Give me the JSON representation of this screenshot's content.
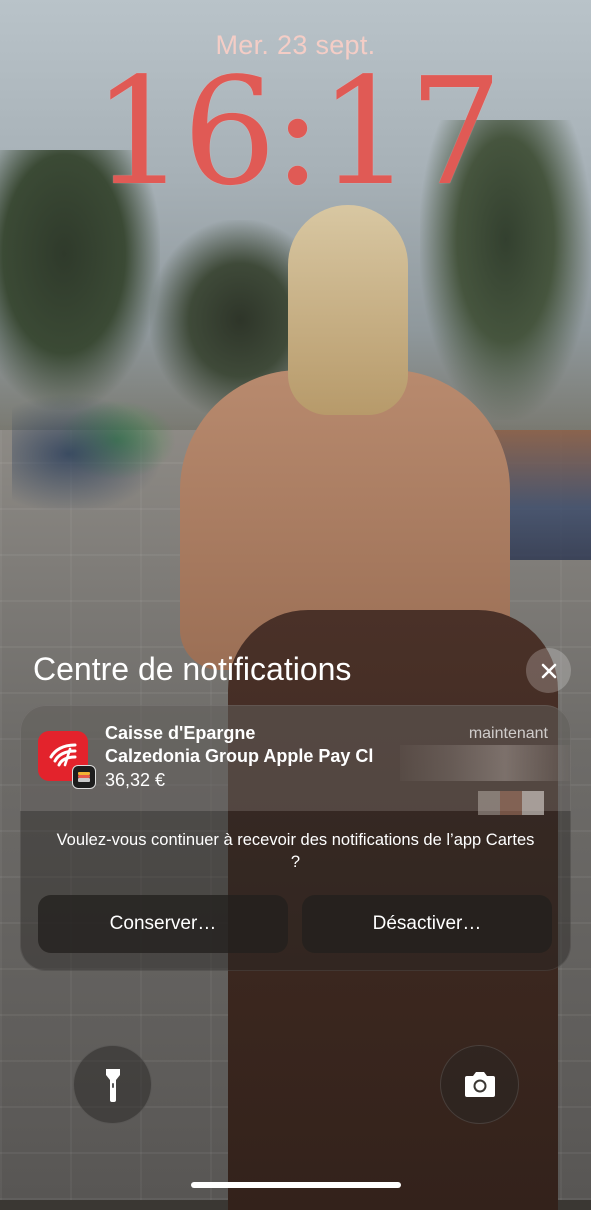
{
  "lockscreen": {
    "date": "Mer. 23 sept.",
    "time": "16:17"
  },
  "notification_center": {
    "title": "Centre de notifications"
  },
  "notification": {
    "app_name": "Caisse d'Epargne",
    "title": "Calzedonia Group Apple Pay Cl",
    "amount": "36,32 €",
    "timestamp": "maintenant",
    "app_icon": "caisse-epargne-icon",
    "badge_icon": "wallet-icon"
  },
  "prompt": {
    "text": "Voulez-vous continuer à recevoir des notifications de l’app Cartes ?",
    "keep_label": "Conserver…",
    "disable_label": "Désactiver…"
  },
  "quick_actions": {
    "flashlight_icon": "flashlight-icon",
    "camera_icon": "camera-icon"
  },
  "colors": {
    "time": "#e05a55",
    "date": "#f4cdc6",
    "app_icon_bg": "#e3232c"
  }
}
